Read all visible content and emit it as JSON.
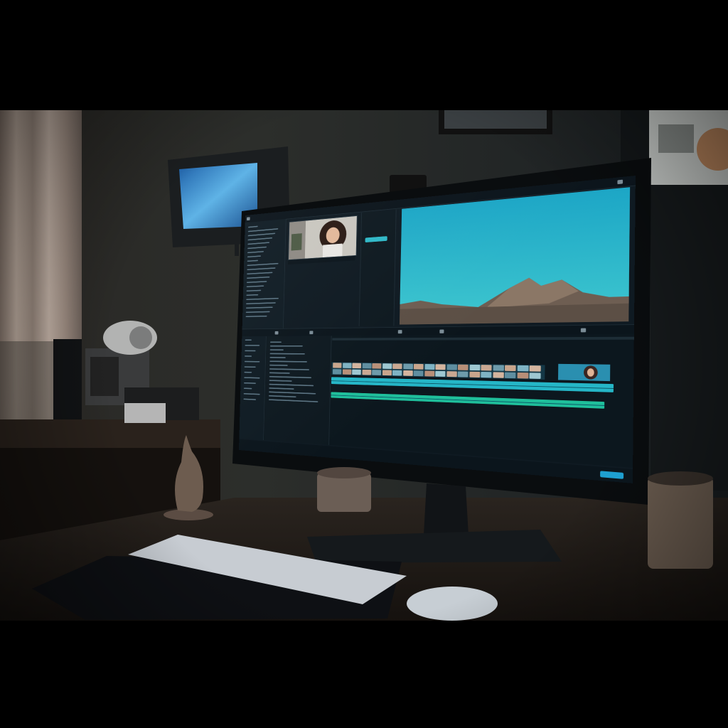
{
  "scene": {
    "kind": "desk-setup-photo",
    "palette": {
      "ui_accent": "#2fb8c7",
      "audio_track": "#25b6c7",
      "audio_track_2": "#1fbf9b",
      "sky": "#1aa9c0"
    },
    "icons": [
      "monitor-icon",
      "keyboard-icon",
      "mouse-icon",
      "speaker-icon",
      "figurine-icon",
      "webcam-icon"
    ]
  },
  "editor_ui": {
    "panels": [
      "media-browser",
      "source-viewer",
      "inspector",
      "program-monitor",
      "timeline"
    ],
    "program_content": "mountain-under-blue-sky",
    "source_content": "portrait-of-woman"
  }
}
